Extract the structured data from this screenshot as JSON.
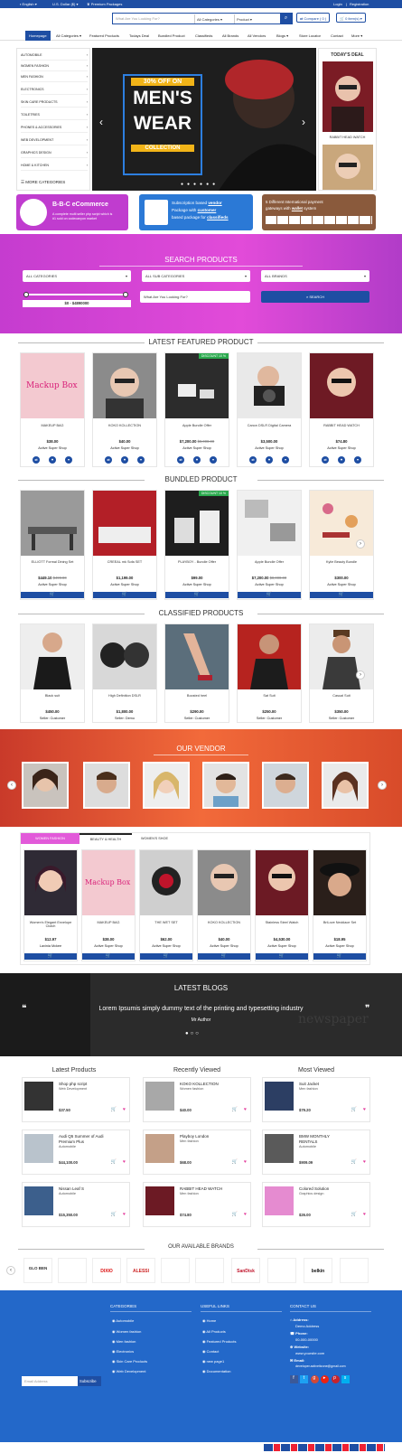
{
  "topbar": {
    "lang": "English",
    "currency": "U.S. Dollar ($)",
    "premium": "Premium Packages",
    "login": "Login",
    "sep": "|",
    "register": "Registration"
  },
  "search": {
    "placeholder": "What Are You Looking For?",
    "category": "All Categories",
    "type": "Product",
    "compare": "Compare ( 0 )",
    "cart": "0 item(s)"
  },
  "nav": [
    "Homepage",
    "All Categories",
    "Featured Products",
    "Todays Deal",
    "Bundled Product",
    "Classifieds",
    "All Brands",
    "All Vendors",
    "Blogs",
    "Store Locator",
    "Contact",
    "More"
  ],
  "categories": [
    "AUTOMOBILE",
    "WOMEN FASHION",
    "MEN FASHION",
    "ELECTRONICS",
    "SKIN CARE PRODUCTS",
    "TOILETRIES",
    "PHONES & ACCESSORIES",
    "WEB DEVELOPMENT",
    "GRAPHICS DESIGN",
    "HOME & KITCHEN"
  ],
  "more_categories": "MORE CATEGORIES",
  "banner": {
    "offer": "30% OFF ON",
    "line1": "MEN'S",
    "line2": "WEAR",
    "line3": "COLLECTION"
  },
  "todays_deal": {
    "title": "TODAY'S DEAL",
    "item": "RABBIT HEAD WATCH"
  },
  "promos": {
    "p1_title": "B-B-C eCommerce",
    "p1_line1": "A complete multi seller php script which is",
    "p1_line2": "#1 sold on codecanyon market",
    "p2_l1a": "Subscription based",
    "p2_l1b": "vendor",
    "p2_l2a": "Package with",
    "p2_l2b": "customer",
    "p2_l3a": "based package for",
    "p2_l3b": "classifieds",
    "p3_l1": "5 Different International payment",
    "p3_l2a": "gateways with",
    "p3_l2b": "wallet",
    "p3_l2c": "system"
  },
  "search_products": {
    "title": "SEARCH PRODUCTS",
    "all_categories": "ALL CATEGORIES",
    "all_sub": "ALL SUB CATEGORIES",
    "all_brands": "ALL BRANDS",
    "range": "$0 - $4890000",
    "placeholder": "What Are You Looking For?",
    "button": "SEARCH"
  },
  "featured": {
    "title": "LATEST FEATURED PRODUCT",
    "items": [
      {
        "name": "MAKEUP BAG",
        "price": "$38.00",
        "old": "",
        "shop": "Active Super Shop",
        "discount": ""
      },
      {
        "name": "KOKO KOLLECTION",
        "price": "$40.00",
        "old": "",
        "shop": "Active Super Shop",
        "discount": ""
      },
      {
        "name": "Apple Bundle Offer",
        "price": "$7,200.00",
        "old": "$8,000.00",
        "shop": "Active Super Shop",
        "discount": "DISCOUNT 10 %"
      },
      {
        "name": "Canon DSLR Digital Camera",
        "price": "$3,500.00",
        "old": "",
        "shop": "Active Super Shop",
        "discount": ""
      },
      {
        "name": "RABBIT HEAD WATCH",
        "price": "$74.80",
        "old": "",
        "shop": "Active Super Shop",
        "discount": ""
      }
    ]
  },
  "bundled": {
    "title": "BUNDLED PRODUCT",
    "items": [
      {
        "name": "ELLIOTT Formal Dining Set",
        "price": "$449.10",
        "old": "$499.00",
        "shop": "Active Super Shop",
        "discount": ""
      },
      {
        "name": "CREEAL mk Sofa SET",
        "price": "$1,199.00",
        "old": "",
        "shop": "Active Super Shop",
        "discount": ""
      },
      {
        "name": "PLAYBOY - Bundle Offer",
        "price": "$99.00",
        "old": "",
        "shop": "Active Super Shop",
        "discount": "DISCOUNT 10 %"
      },
      {
        "name": "Apple Bundle Offer",
        "price": "$7,200.00",
        "old": "$8,000.00",
        "shop": "Active Super Shop",
        "discount": ""
      },
      {
        "name": "Kylie Beauty Bundle",
        "price": "$300.00",
        "old": "",
        "shop": "Active Super Shop",
        "discount": ""
      }
    ]
  },
  "classified": {
    "title": "CLASSIFIED PRODUCTS",
    "items": [
      {
        "name": "Black suit",
        "price": "$450.00",
        "shop": "Seller: Customer"
      },
      {
        "name": "High Definition DSLR",
        "price": "$1,800.00",
        "shop": "Seller: Demo"
      },
      {
        "name": "Boosted heel",
        "price": "$290.00",
        "shop": "Seller: Customer"
      },
      {
        "name": "Sat Suit",
        "price": "$250.00",
        "shop": "Seller: Customer"
      },
      {
        "name": "Casual Suit",
        "price": "$350.00",
        "shop": "Seller: Customer"
      }
    ]
  },
  "vendor": {
    "title": "OUR VENDOR"
  },
  "tabs": {
    "labels": [
      "WOMEN FASHION",
      "BEAUTY & HEALTH",
      "WOMEN'S SHOE"
    ],
    "items": [
      {
        "name": "Women's Elegant Envelope Clutch",
        "price": "$12.97",
        "shop": "Lavinia Mckee"
      },
      {
        "name": "MAKEUP BAG",
        "price": "$38.00",
        "shop": "Active Super Shop"
      },
      {
        "name": "THE WET SET",
        "price": "$62.00",
        "shop": "Active Super Shop"
      },
      {
        "name": "KOKO KOLLECTION",
        "price": "$40.00",
        "shop": "Active Super Shop"
      },
      {
        "name": "Stainless Steel Watch",
        "price": "$4,530.00",
        "shop": "Active Super Shop"
      },
      {
        "name": "BriLove Necklace Set",
        "price": "$18.95",
        "shop": "Active Super Shop"
      }
    ]
  },
  "blogs": {
    "title": "LATEST BLOGS",
    "quote": "Lorem Ipsumis simply dummy text of the printing and typesetting industry",
    "author": "Mr Author"
  },
  "latest_products": {
    "title": "Latest Products",
    "items": [
      {
        "name": "Shop php script",
        "name2": "",
        "sub": "Web Development",
        "price": "$37.50"
      },
      {
        "name": "Audi Q5 Summer of Audi",
        "name2": "Premium Plus",
        "sub": "Automobile",
        "price": "$44,100.00"
      },
      {
        "name": "Nissan Leaf S",
        "name2": "",
        "sub": "Automobile",
        "price": "$15,350.00"
      }
    ]
  },
  "recently_viewed": {
    "title": "Recently Viewed",
    "items": [
      {
        "name": "KOKO KOLLECTION",
        "name2": "",
        "sub": "Women fashion",
        "price": "$40.00"
      },
      {
        "name": "Playboy London",
        "name2": "",
        "sub": "Men fashion",
        "price": "$68.00"
      },
      {
        "name": "RABBIT HEAD WATCH",
        "name2": "",
        "sub": "Men fashion",
        "price": "$74.80"
      }
    ]
  },
  "most_viewed": {
    "title": "Most Viewed",
    "items": [
      {
        "name": "Suit Jacket",
        "name2": "",
        "sub": "Men fashion",
        "price": "$79.20"
      },
      {
        "name": "BMW MONTHLY",
        "name2": "RENTALS",
        "sub": "Automobile",
        "price": "$909.09"
      },
      {
        "name": "Colored Solution",
        "name2": "",
        "sub": "Graphics design",
        "price": "$26.00"
      }
    ]
  },
  "brands": {
    "title": "OUR AVAILABLE BRANDS",
    "items": [
      "GLO BEN",
      "",
      "DIXIO",
      "ALESSI",
      "",
      "",
      "SanDisk",
      "",
      "belkin",
      ""
    ]
  },
  "footer": {
    "categories_title": "CATEGORIES",
    "categories": [
      "Automobile",
      "Women fashion",
      "Men fashion",
      "Electronics",
      "Skin Care Products",
      "Web Development"
    ],
    "links_title": "USEFUL LINKS",
    "links": [
      "Home",
      "All Products",
      "Featured Products",
      "Contact",
      "new page1",
      "Documentation"
    ],
    "contact_title": "CONTACT US",
    "address_label": "Address:",
    "address": "Demo Address",
    "phone_label": "Phone:",
    "phone": "00-000-00000",
    "website_label": "Website:",
    "website": "www.yoursite.com",
    "email_label": "Email:",
    "email": "developer.activeitzone@gmail.com",
    "newsletter_placeholder": "Email Address",
    "subscribe": "Subscribe"
  },
  "colors": {
    "primary": "#1e4ea3",
    "purple": "#d444d6",
    "orange": "#f2663a",
    "footer": "#2368c9"
  }
}
